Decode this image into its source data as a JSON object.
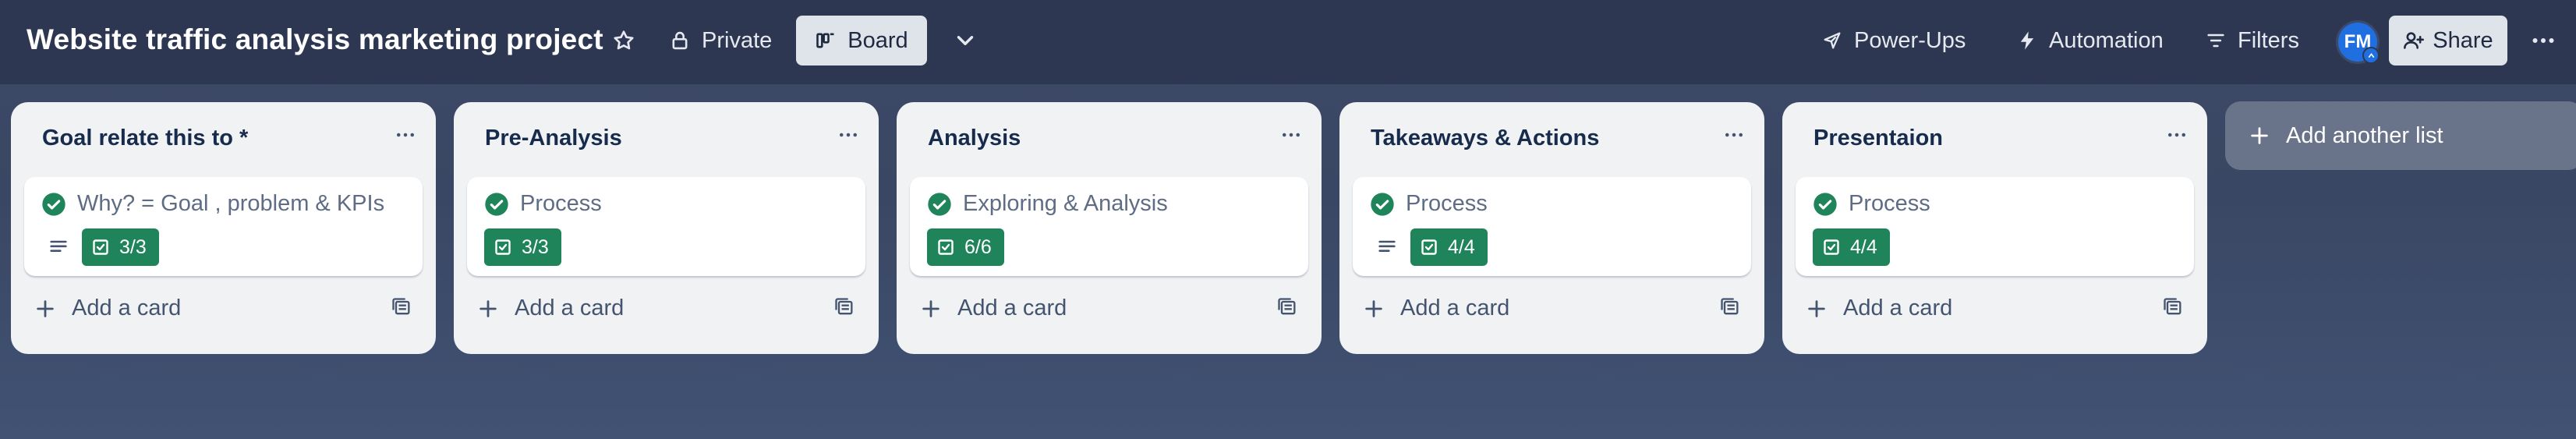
{
  "header": {
    "board_title": "Website traffic analysis marketing project",
    "private_label": "Private",
    "board_view_label": "Board",
    "powerups_label": "Power-Ups",
    "automation_label": "Automation",
    "filters_label": "Filters",
    "avatar_initials": "FM",
    "share_label": "Share"
  },
  "lists": [
    {
      "title": "Goal relate this to *",
      "card": {
        "title": "Why? = Goal , problem & KPIs",
        "checklist": "3/3",
        "has_description": true
      },
      "add_card_label": "Add a card"
    },
    {
      "title": "Pre-Analysis",
      "card": {
        "title": "Process",
        "checklist": "3/3",
        "has_description": false
      },
      "add_card_label": "Add a card"
    },
    {
      "title": "Analysis",
      "card": {
        "title": "Exploring & Analysis",
        "checklist": "6/6",
        "has_description": false
      },
      "add_card_label": "Add a card"
    },
    {
      "title": "Takeaways & Actions",
      "card": {
        "title": "Process",
        "checklist": "4/4",
        "has_description": true
      },
      "add_card_label": "Add a card"
    },
    {
      "title": "Presentaion",
      "card": {
        "title": "Process",
        "checklist": "4/4",
        "has_description": false
      },
      "add_card_label": "Add a card"
    }
  ],
  "add_list_label": "Add another list",
  "colors": {
    "header_bg": "#2d3752",
    "board_bg": "#3d4a66",
    "list_bg": "#f1f2f4",
    "checklist_complete": "#1f845a",
    "avatar": "#1f6fe0"
  }
}
